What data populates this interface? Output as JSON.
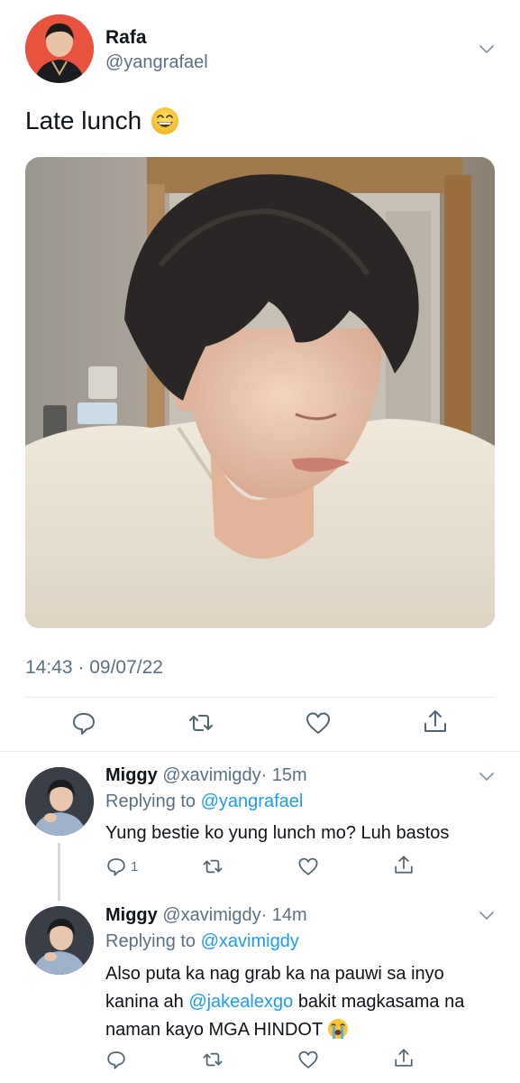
{
  "tweet": {
    "author_name": "Rafa",
    "author_handle": "@yangrafael",
    "text": "Late lunch",
    "emoji": "grinning-face",
    "timestamp": "14:43 · 09/07/22",
    "actions": [
      "reply-icon",
      "retweet-icon",
      "like-icon",
      "share-icon"
    ]
  },
  "replies": [
    {
      "author_name": "Miggy",
      "author_handle": "@xavimigdy",
      "time": "· 15m",
      "replying_prefix": "Replying to",
      "replying_to": "@yangrafael",
      "text": "Yung bestie ko yung lunch mo? Luh bastos",
      "reply_count": "1"
    },
    {
      "author_name": "Miggy",
      "author_handle": "@xavimigdy",
      "time": "· 14m",
      "replying_prefix": "Replying to",
      "replying_to": "@xavimigdy",
      "text_part1": "Also puta ka nag grab ka na pauwi sa inyo kanina ah",
      "mention": "@jakealexgo",
      "text_part2": "bakit magkasama na naman kayo MGA HINDOT",
      "emoji": "loudly-crying-face"
    }
  ],
  "colors": {
    "link": "#1d9bf0",
    "secondary_text": "#5b7083",
    "icon": "#536471",
    "divider": "#e6ecf0"
  }
}
